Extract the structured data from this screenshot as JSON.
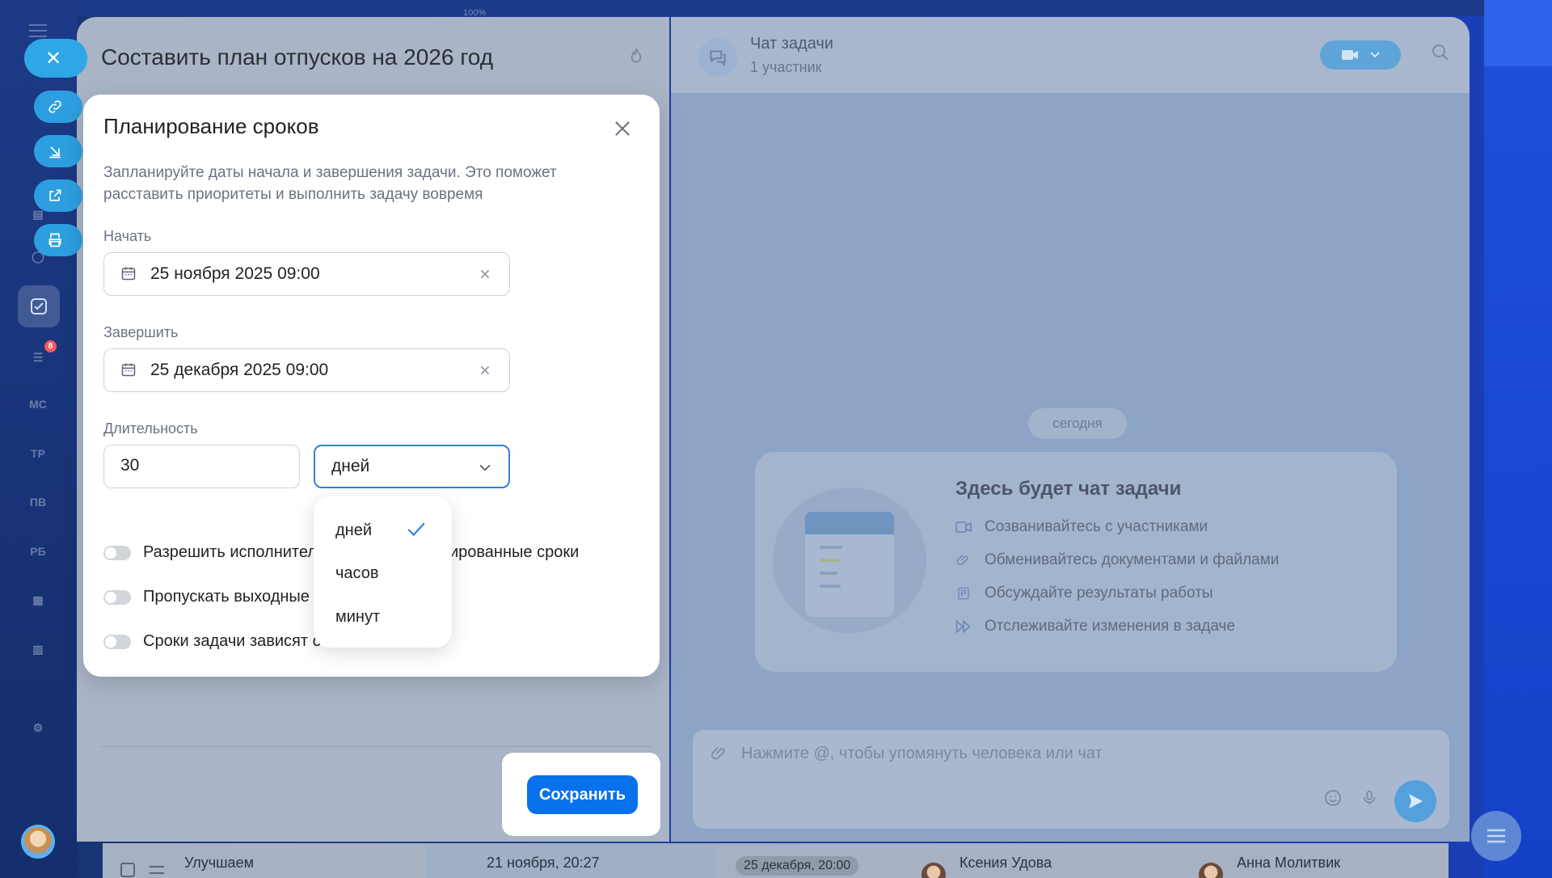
{
  "top_strip": {
    "zoom": "100%"
  },
  "rail": {
    "badge_count": "8",
    "items": [
      "МС",
      "ТР",
      "ПВ",
      "РБ"
    ]
  },
  "task": {
    "title": "Составить план отпусков на 2026 год"
  },
  "chat": {
    "title": "Чат задачи",
    "subtitle": "1 участник",
    "today_label": "сегодня",
    "card_title": "Здесь будет чат задачи",
    "features": [
      "Созванивайтесь с участниками",
      "Обменивайтесь документами и файлами",
      "Обсуждайте результаты работы",
      "Отслеживайте изменения в задаче"
    ],
    "input_placeholder": "Нажмите @, чтобы упомянуть человека или чат"
  },
  "modal": {
    "title": "Планирование сроков",
    "description": "Запланируйте даты начала и завершения задачи. Это поможет расставить приоритеты и выполнить задачу вовремя",
    "start_label": "Начать",
    "start_value": "25 ноября 2025 09:00",
    "end_label": "Завершить",
    "end_value": "25 декабря 2025 09:00",
    "duration_label": "Длительность",
    "duration_value": "30",
    "unit_selected": "дней",
    "toggles": [
      {
        "left": "Разрешить исполнител",
        "right": "ированные сроки"
      },
      {
        "left": "Пропускать выходные д",
        "right": ""
      },
      {
        "left": "Сроки задачи зависят от",
        "right": ""
      }
    ],
    "unit_options": [
      "дней",
      "часов",
      "минут"
    ]
  },
  "save_button": "Сохранить",
  "bottom_row": {
    "name": "Улучшаем",
    "created": "21 ноября, 20:27",
    "deadline": "25 декабря, 20:00",
    "assignee": "Ксения Удова",
    "creator": "Анна Молитвик"
  }
}
